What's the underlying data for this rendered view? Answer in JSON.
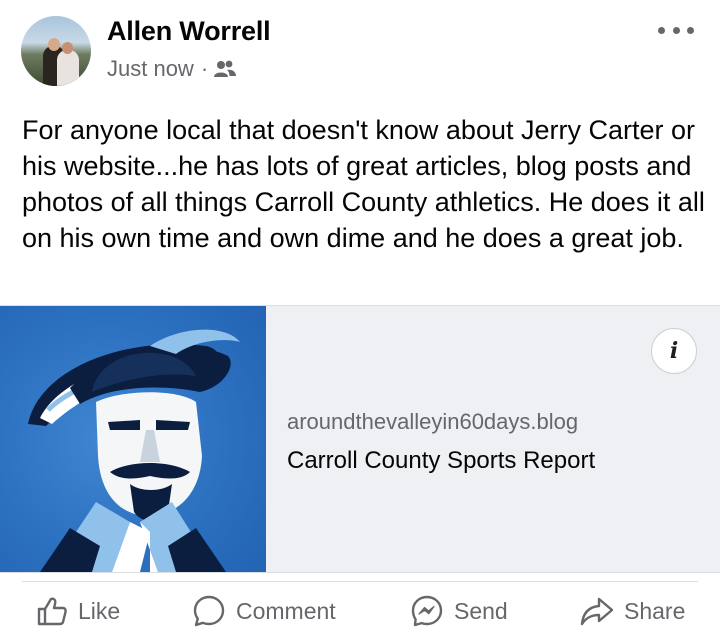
{
  "post": {
    "author": "Allen Worrell",
    "timestamp": "Just now",
    "separator": "·",
    "audience_icon": "friends-icon",
    "more_icon": "more-options-icon",
    "text": "For anyone local that doesn't know about Jerry Carter or his website...he has lots of great articles, blog posts and photos of all things Carroll County athletics. He does it all on his own time and own dime and he does a great job."
  },
  "link_preview": {
    "domain": "aroundthevalleyin60days.blog",
    "title": "Carroll County Sports Report",
    "info_label": "i",
    "thumbnail_icon": "cavalier-logo",
    "colors": {
      "thumb_bg": "#2b6fbf",
      "navy": "#0b1e3f",
      "light_blue": "#8fc1ea"
    }
  },
  "actions": [
    {
      "label": "Like",
      "icon": "thumbs-up-icon"
    },
    {
      "label": "Comment",
      "icon": "comment-icon"
    },
    {
      "label": "Send",
      "icon": "messenger-icon"
    },
    {
      "label": "Share",
      "icon": "share-icon"
    }
  ]
}
